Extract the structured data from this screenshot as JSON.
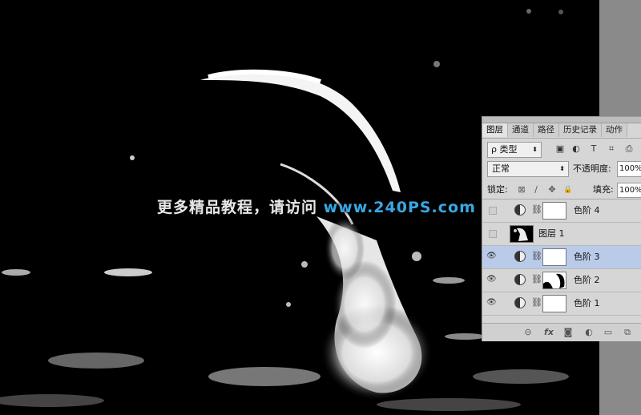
{
  "watermark": {
    "prefix": "更多精品教程，请访问 ",
    "url": "www.240PS.com"
  },
  "panel": {
    "tabs": [
      "图层",
      "通道",
      "路径",
      "历史记录",
      "动作"
    ],
    "filter": {
      "search_glyph": "ρ",
      "kind": "类型",
      "arrow": "⬍",
      "icons": [
        "▣",
        "◐",
        "T",
        "⌗",
        "⎙"
      ]
    },
    "blend_mode": "正常",
    "blend_arrow": "⬍",
    "opacity_label": "不透明度:",
    "opacity_value": "100%",
    "lock_label": "锁定:",
    "lock_icons": [
      "⊠",
      "∕",
      "✥",
      "🔒"
    ],
    "fill_label": "填充:",
    "fill_value": "100%",
    "layers": [
      {
        "name": "色阶 4",
        "visible": false,
        "type": "adjustment",
        "selected": false
      },
      {
        "name": "图层 1",
        "visible": false,
        "type": "pixel",
        "selected": false
      },
      {
        "name": "色阶 3",
        "visible": true,
        "type": "adjustment",
        "selected": true
      },
      {
        "name": "色阶 2",
        "visible": true,
        "type": "adjustment",
        "selected": false
      },
      {
        "name": "色阶 1",
        "visible": true,
        "type": "adjustment",
        "selected": false
      }
    ],
    "eye_glyph": "👁",
    "chain_glyph": "⛓",
    "bottom_icons": [
      "⊝",
      "fx",
      "◙",
      "◐",
      "▭",
      "⧉"
    ]
  },
  "colors": {
    "url": "#3aa7e4",
    "selected_layer": "#b9cbe8",
    "panel_bg": "#d6d6d6"
  }
}
